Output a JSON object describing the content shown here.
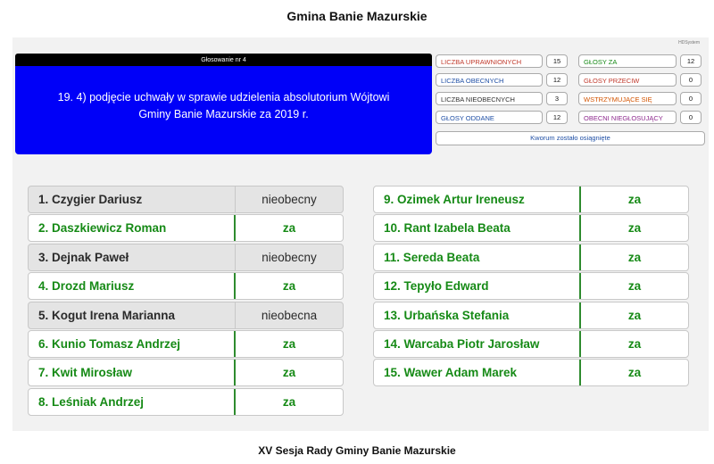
{
  "page_title": "Gmina Banie Mazurskie",
  "footer_title": "XV Sesja Rady Gminy Banie Mazurskie",
  "screen": {
    "system_label": "HDSystem",
    "vote_header": "Głosowanie nr 4",
    "vote_topic": "19. 4) podjęcie uchwały w sprawie udzielenia absolutorium Wójtowi Gminy Banie Mazurskie za 2019 r.",
    "stats": [
      {
        "label": "LICZBA UPRAWNIONYCH",
        "value": "15",
        "color": "#c0392b"
      },
      {
        "label": "GŁOSY ZA",
        "value": "12",
        "color": "#168a16"
      },
      {
        "label": "LICZBA OBECNYCH",
        "value": "12",
        "color": "#1f4fa5"
      },
      {
        "label": "GŁOSY PRZECIW",
        "value": "0",
        "color": "#c0392b"
      },
      {
        "label": "LICZBA NIEOBECNYCH",
        "value": "3",
        "color": "#333333"
      },
      {
        "label": "WSTRZYMUJĄCE SIĘ",
        "value": "0",
        "color": "#d35400"
      },
      {
        "label": "GŁOSY ODDANE",
        "value": "12",
        "color": "#1f4fa5"
      },
      {
        "label": "OBECNI NIEGŁOSUJĄCY",
        "value": "0",
        "color": "#8e2a8e"
      }
    ],
    "quorum": "Kworum zostało osiągnięte",
    "members": [
      {
        "name": "1. Czygier Dariusz",
        "status": "nieobecny",
        "present": false
      },
      {
        "name": "2. Daszkiewicz Roman",
        "status": "za",
        "present": true
      },
      {
        "name": "3. Dejnak Paweł",
        "status": "nieobecny",
        "present": false
      },
      {
        "name": "4. Drozd Mariusz",
        "status": "za",
        "present": true
      },
      {
        "name": "5. Kogut Irena Marianna",
        "status": "nieobecna",
        "present": false
      },
      {
        "name": "6. Kunio Tomasz Andrzej",
        "status": "za",
        "present": true
      },
      {
        "name": "7. Kwit Mirosław",
        "status": "za",
        "present": true
      },
      {
        "name": "8. Leśniak Andrzej",
        "status": "za",
        "present": true
      },
      {
        "name": "9. Ozimek Artur Ireneusz",
        "status": "za",
        "present": true
      },
      {
        "name": "10. Rant Izabela Beata",
        "status": "za",
        "present": true
      },
      {
        "name": "11. Sereda Beata",
        "status": "za",
        "present": true
      },
      {
        "name": "12. Tepyło Edward",
        "status": "za",
        "present": true
      },
      {
        "name": "13. Urbańska Stefania",
        "status": "za",
        "present": true
      },
      {
        "name": "14. Warcaba Piotr Jarosław",
        "status": "za",
        "present": true
      },
      {
        "name": "15. Wawer Adam Marek",
        "status": "za",
        "present": true
      }
    ]
  }
}
